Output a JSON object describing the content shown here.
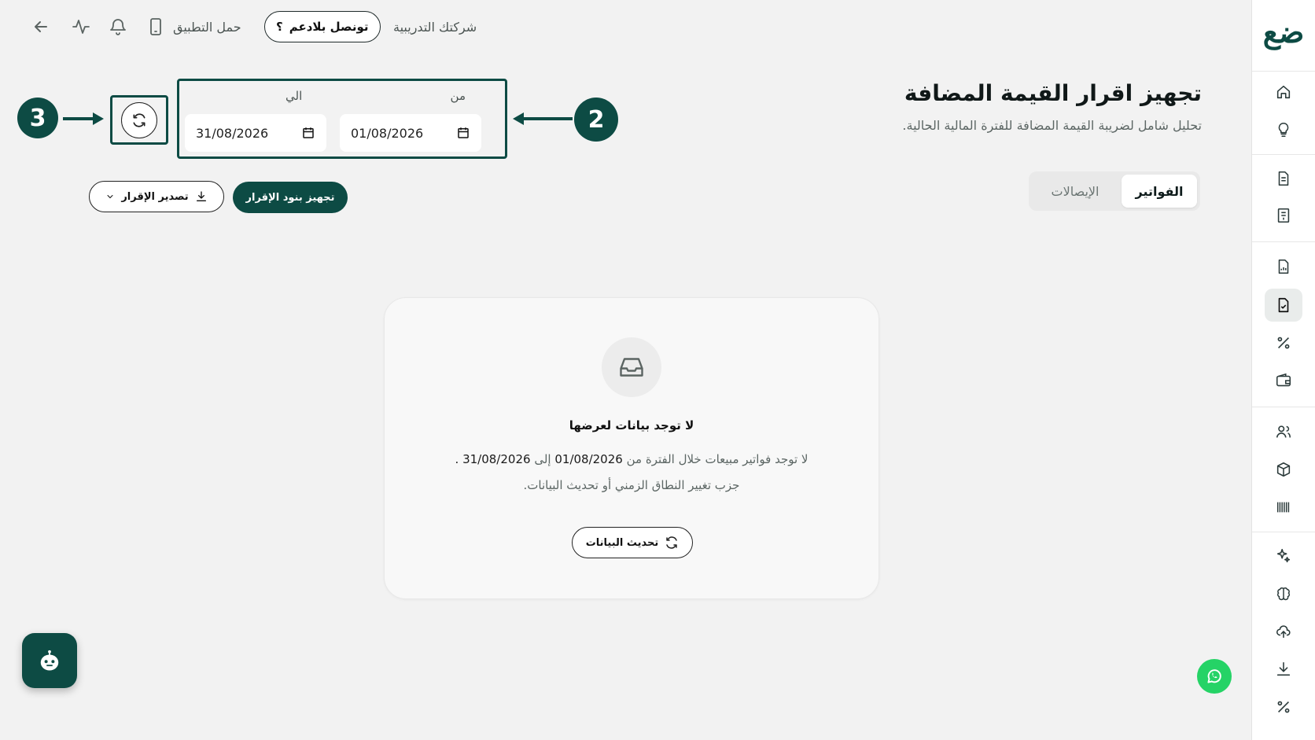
{
  "header": {
    "company": "شركتك التدريبية",
    "support_label": "تونصل بلادعم",
    "support_mark": "؟",
    "download_app": "حمل التطبيق"
  },
  "page": {
    "title": "تجهيز اقرار القيمة المضافة",
    "subtitle": "تحليل شامل لضريبة القيمة المضافة للفترة المالية الحالية."
  },
  "tabs": [
    {
      "label": "الفواتير",
      "active": true
    },
    {
      "label": "الإيصالات",
      "active": false
    }
  ],
  "date_range": {
    "from_label": "من",
    "from_value": "01/08/2026",
    "to_label": "الي",
    "to_value": "31/08/2026"
  },
  "callouts": {
    "date_box": "2",
    "refresh": "3"
  },
  "actions": {
    "prepare": "تجهيز بنود الإقرار",
    "export": "تصدير الإقرار"
  },
  "empty_state": {
    "title": "لا توجد بيانات لعرضها",
    "line1_prefix": "لا توجد فواتير مبيعات خلال الفترة من",
    "line1_from": "01/08/2026",
    "line1_mid": "إلى",
    "line1_to": "31/08/2026",
    "line1_suffix": ".",
    "line2": "جزب تغيير النطاق الزمني أو تحديث البيانات.",
    "refresh_button": "تحديث البيانات"
  },
  "sidebar": {
    "logo": "ضع",
    "items": [
      "home-icon",
      "lightbulb-icon",
      "document-icon",
      "receipt-icon",
      "report-icon",
      "checked-document-icon",
      "percent-icon",
      "wallet-icon",
      "users-icon",
      "box-icon",
      "barcode-icon",
      "sparkle-icon",
      "brain-icon",
      "upload-cloud-icon",
      "download-icon",
      "percent-icon"
    ],
    "active_item": "checked-document-icon"
  },
  "colors": {
    "brand": "#0d4b44",
    "background": "#f2f2f2",
    "whatsapp": "#25d366"
  }
}
